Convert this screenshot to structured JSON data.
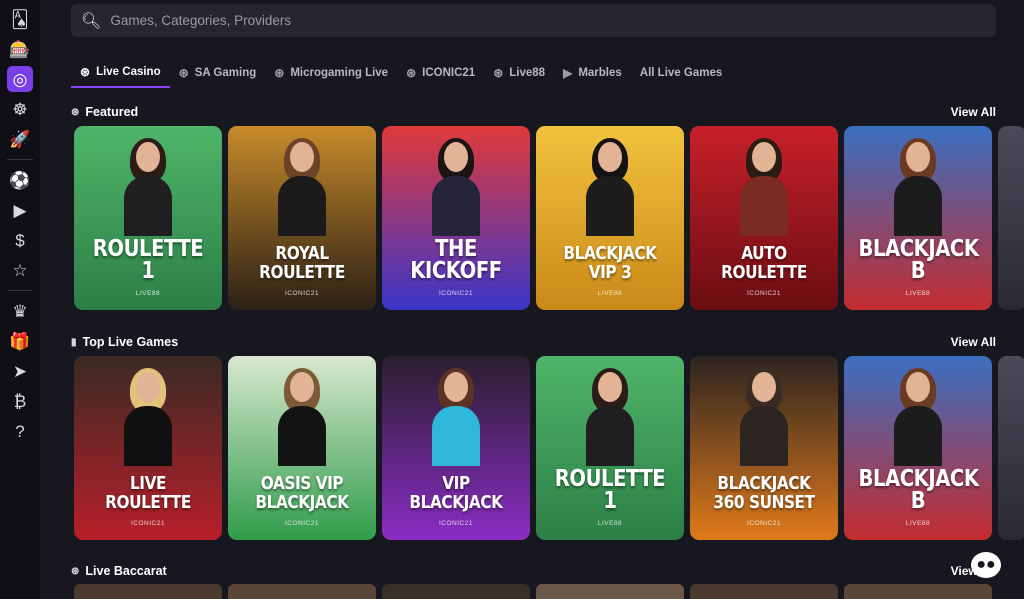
{
  "sidebar": {
    "icons": [
      {
        "name": "cards-icon",
        "glyph": "🂡"
      },
      {
        "name": "slot-machine-icon",
        "glyph": "🎰"
      },
      {
        "name": "live-casino-icon",
        "glyph": "◎",
        "active": true
      },
      {
        "name": "roulette-icon",
        "glyph": "☸"
      },
      {
        "name": "rocket-icon",
        "glyph": "🚀"
      },
      {
        "name": "sports-icon",
        "glyph": "⚽"
      },
      {
        "name": "play-icon",
        "glyph": "▶"
      },
      {
        "name": "coin-icon",
        "glyph": "$"
      },
      {
        "name": "star-icon",
        "glyph": "☆"
      },
      {
        "name": "vip-icon",
        "glyph": "♛"
      },
      {
        "name": "gift-icon",
        "glyph": "🎁"
      },
      {
        "name": "telegram-icon",
        "glyph": "➤"
      },
      {
        "name": "bitcoin-icon",
        "glyph": "₿"
      },
      {
        "name": "support-icon",
        "glyph": "?"
      }
    ]
  },
  "search": {
    "placeholder": "Games, Categories, Providers",
    "value": ""
  },
  "tabs": [
    {
      "label": "Live Casino",
      "icon": "chip-icon",
      "active": true
    },
    {
      "label": "SA Gaming",
      "icon": "chip-icon"
    },
    {
      "label": "Microgaming Live",
      "icon": "chip-icon"
    },
    {
      "label": "ICONIC21",
      "icon": "chip-icon"
    },
    {
      "label": "Live88",
      "icon": "chip-icon"
    },
    {
      "label": "Marbles",
      "icon": "play-circle-icon"
    },
    {
      "label": "All Live Games",
      "icon": ""
    }
  ],
  "sections": [
    {
      "title": "Featured",
      "view_all": "View All",
      "cards": [
        {
          "title": "ROULETTE 1",
          "provider": "LIVE88",
          "bg1": "#4fb56a",
          "bg2": "#2c7f45",
          "hair": "#2a1d18",
          "body": "#1f1f22"
        },
        {
          "title": "ROYAL ROULETTE",
          "provider": "ICONIC21",
          "bg1": "#c78a2a",
          "bg2": "#2b2016",
          "hair": "#6b4427",
          "body": "#1b1b1b"
        },
        {
          "title": "THE KICKOFF",
          "provider": "ICONIC21",
          "bg1": "#e03a3a",
          "bg2": "#3a36c9",
          "hair": "#1a1414",
          "body": "#25243a"
        },
        {
          "title": "BLACKJACK VIP 3",
          "provider": "LIVE88",
          "bg1": "#f2c23e",
          "bg2": "#c98a17",
          "hair": "#171212",
          "body": "#1d1d1d"
        },
        {
          "title": "AUTO ROULETTE",
          "provider": "ICONIC21",
          "bg1": "#c7202a",
          "bg2": "#6a0d12",
          "hair": "#2a1b14",
          "body": "#7a2b22"
        },
        {
          "title": "BLACKJACK B",
          "provider": "LIVE88",
          "bg1": "#3a6fc0",
          "bg2": "#c42c30",
          "hair": "#6b3a22",
          "body": "#1c1c1c"
        }
      ]
    },
    {
      "title": "Top Live Games",
      "view_all": "View All",
      "cards": [
        {
          "title": "LIVE ROULETTE",
          "provider": "ICONIC21",
          "bg1": "#3a2a24",
          "bg2": "#b81f2a",
          "hair": "#e2c27a",
          "body": "#101010"
        },
        {
          "title": "OASIS VIP BLACKJACK",
          "provider": "ICONIC21",
          "bg1": "#d8e8d0",
          "bg2": "#2f9c4a",
          "hair": "#7b5a38",
          "body": "#131313"
        },
        {
          "title": "VIP BLACKJACK",
          "provider": "ICONIC21",
          "bg1": "#2a1f2e",
          "bg2": "#8a2cc4",
          "hair": "#5a3322",
          "body": "#2fb7d9"
        },
        {
          "title": "ROULETTE 1",
          "provider": "LIVE88",
          "bg1": "#4fb56a",
          "bg2": "#2c7f45",
          "hair": "#2a1d18",
          "body": "#1f1f22"
        },
        {
          "title": "BLACKJACK 360 SUNSET",
          "provider": "ICONIC21",
          "bg1": "#2c2420",
          "bg2": "#e07a1c",
          "hair": "#3a2c22",
          "body": "#2c2420"
        },
        {
          "title": "BLACKJACK B",
          "provider": "LIVE88",
          "bg1": "#3a6fc0",
          "bg2": "#c42c30",
          "hair": "#6b3a22",
          "body": "#1c1c1c"
        }
      ]
    },
    {
      "title": "Live Baccarat",
      "view_all": "View All",
      "cards": []
    }
  ],
  "chat": {
    "glyph": "💬"
  }
}
